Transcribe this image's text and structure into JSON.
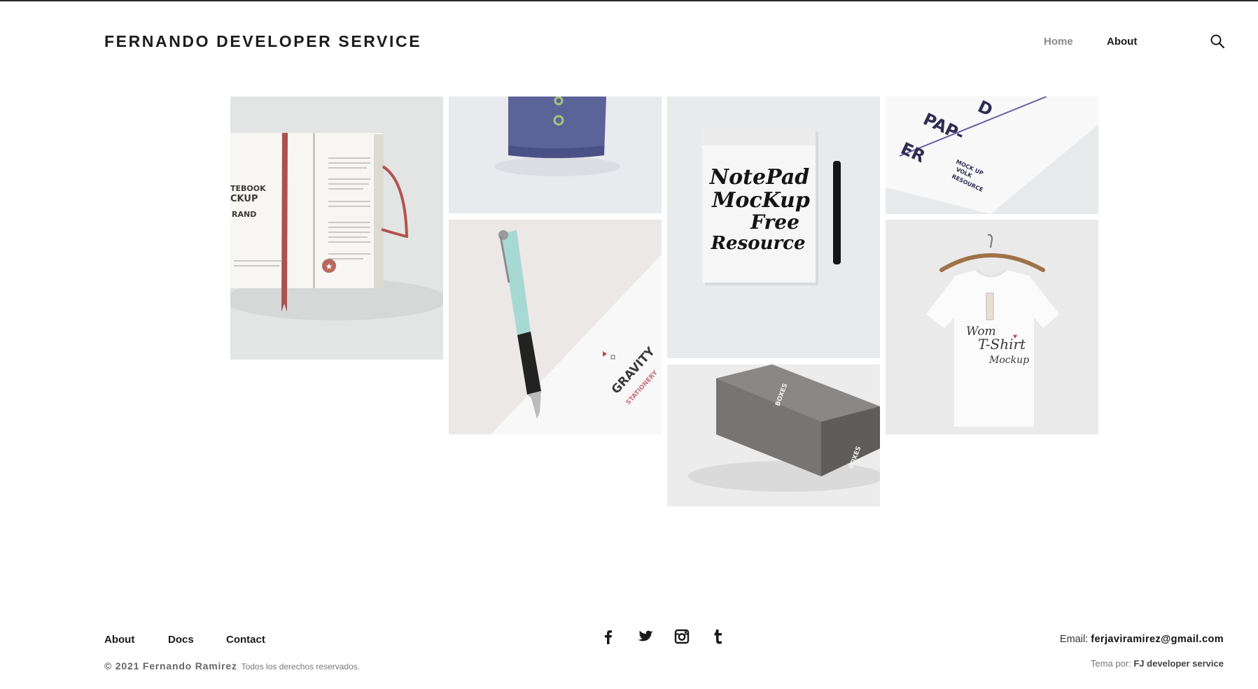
{
  "header": {
    "site_title": "FERNANDO DEVELOPER SERVICE",
    "nav": [
      {
        "label": "Home",
        "active": true
      },
      {
        "label": "About",
        "active": false
      }
    ],
    "search_icon": "search-icon"
  },
  "gallery": {
    "images": [
      {
        "name": "notebook-mockup",
        "text": [
          "TEBOOK",
          "CKUP",
          "RAND"
        ]
      },
      {
        "name": "blue-shirt-mockup"
      },
      {
        "name": "notepad-mockup",
        "text": [
          "NotePad",
          "MocKup",
          "Free",
          "Resource"
        ]
      },
      {
        "name": "paper-mockup",
        "text": [
          "D",
          "PAP-",
          "ER",
          "MOCK UP",
          "VOLK",
          "RESOURCE"
        ]
      },
      {
        "name": "pen-stationery-mockup",
        "text": [
          "GRAVITY",
          "STATIONERY"
        ]
      },
      {
        "name": "tshirt-mockup",
        "text": [
          "Wom",
          "T-Shirt",
          "Mockup"
        ]
      },
      {
        "name": "boxes-mockup",
        "text": [
          "BOXES",
          "BOXES"
        ]
      }
    ]
  },
  "footer": {
    "links": [
      {
        "label": "About"
      },
      {
        "label": "Docs"
      },
      {
        "label": "Contact"
      }
    ],
    "copyright_prefix": "© 2021 Fernando Ramirez",
    "copyright_suffix": "Todos los derechos reservados.",
    "social": [
      "facebook-icon",
      "twitter-icon",
      "instagram-icon",
      "tumblr-icon"
    ],
    "email_label": "Email:",
    "email": "ferjaviramirez@gmail.com",
    "theme_label": "Tema por:",
    "theme_by": "FJ developer service"
  },
  "colors": {
    "nav_active": "#8a8a8a",
    "text": "#1a1a1a",
    "topbar": "#2a2a2a"
  }
}
